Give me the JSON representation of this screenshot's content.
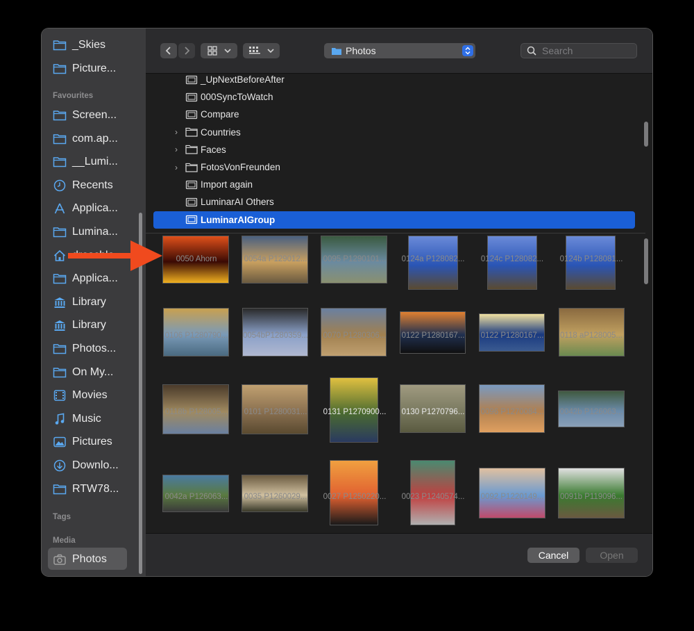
{
  "sidebar": {
    "top_items": [
      {
        "label": "_Skies",
        "icon": "folder-icon"
      },
      {
        "label": "Picture...",
        "icon": "folder-icon"
      }
    ],
    "favourites_header": "Favourites",
    "favourites": [
      {
        "label": "Screen...",
        "icon": "folder-icon"
      },
      {
        "label": "com.ap...",
        "icon": "folder-icon"
      },
      {
        "label": "__Lumi...",
        "icon": "folder-icon"
      },
      {
        "label": "Recents",
        "icon": "clock-icon"
      },
      {
        "label": "Applica...",
        "icon": "apps-icon"
      },
      {
        "label": "Lumina...",
        "icon": "folder-icon"
      },
      {
        "label": "dreschle",
        "icon": "home-icon"
      },
      {
        "label": "Applica...",
        "icon": "folder-icon"
      },
      {
        "label": "Library",
        "icon": "library-icon"
      },
      {
        "label": "Library",
        "icon": "library-icon"
      },
      {
        "label": "Photos...",
        "icon": "folder-icon"
      },
      {
        "label": "On My...",
        "icon": "folder-icon"
      },
      {
        "label": "Movies",
        "icon": "film-icon"
      },
      {
        "label": "Music",
        "icon": "music-icon"
      },
      {
        "label": "Pictures",
        "icon": "pictures-icon"
      },
      {
        "label": "Downlo...",
        "icon": "download-icon"
      },
      {
        "label": "RTW78...",
        "icon": "folder-icon"
      }
    ],
    "tags_header": "Tags",
    "media_header": "Media",
    "media_item": {
      "label": "Photos",
      "icon": "camera-icon"
    }
  },
  "toolbar": {
    "back_icon": "chevron-left-icon",
    "forward_icon": "chevron-right-icon",
    "view_icon": "grid-icon",
    "group_icon": "group-icon",
    "location": "Photos",
    "search_placeholder": "Search"
  },
  "list": {
    "rows": [
      {
        "label": "_UpNextBeforeAfter",
        "disclosure": ""
      },
      {
        "label": "000SyncToWatch",
        "disclosure": ""
      },
      {
        "label": "Compare",
        "disclosure": ""
      },
      {
        "label": "Countries",
        "disclosure": "›"
      },
      {
        "label": "Faces",
        "disclosure": "›"
      },
      {
        "label": "FotosVonFreunden",
        "disclosure": "›"
      },
      {
        "label": "Import again",
        "disclosure": ""
      },
      {
        "label": "LuminarAI Others",
        "disclosure": ""
      },
      {
        "label": "LuminarAIGroup",
        "disclosure": ""
      }
    ]
  },
  "grid": {
    "thumbs": [
      {
        "caption": "0050 Ahorn",
        "colors": [
          "#3a0a04",
          "#e0501a",
          "#f0b020"
        ]
      },
      {
        "caption": "0054a P129012...",
        "colors": [
          "#c9a060",
          "#4a6080",
          "#6a5a40"
        ]
      },
      {
        "caption": "0095 P1290101...",
        "colors": [
          "#6a8aa0",
          "#3a5a40",
          "#8a9070"
        ]
      },
      {
        "caption": "0124a P128082...",
        "colors": [
          "#2a55b5",
          "#6a8ad8",
          "#5a4a30"
        ]
      },
      {
        "caption": "0124c P128082...",
        "colors": [
          "#2a55b5",
          "#6a8ad8",
          "#5a4a30"
        ]
      },
      {
        "caption": "0124b P128081...",
        "colors": [
          "#2a55b5",
          "#6a8ad8",
          "#5a4a30"
        ]
      },
      {
        "caption": "0106 P1280790...",
        "colors": [
          "#7a9ab8",
          "#c8a050",
          "#4a6a80"
        ]
      },
      {
        "caption": "0054bP1280359...",
        "colors": [
          "#8aa0c8",
          "#2a2a2a",
          "#b0b8d0"
        ]
      },
      {
        "caption": "0070 P1280306...",
        "colors": [
          "#a08050",
          "#6a80a0",
          "#c0a070"
        ]
      },
      {
        "caption": "0122 P1280167...",
        "colors": [
          "#203050",
          "#e08030",
          "#101010"
        ]
      },
      {
        "caption": "0122 P1280167...",
        "colors": [
          "#1a3a80",
          "#f0e0a0",
          "#3a5a90"
        ]
      },
      {
        "caption": "0118 aP128005...",
        "colors": [
          "#c0a060",
          "#8a6a40",
          "#6a8a50"
        ]
      },
      {
        "caption": "0118b P128005...",
        "colors": [
          "#a08a60",
          "#4a3a2a",
          "#6a80a0"
        ]
      },
      {
        "caption": "0101 P1280031...",
        "colors": [
          "#8a7050",
          "#c0a070",
          "#5a4a30"
        ]
      },
      {
        "caption": "0131 P1270900...",
        "colors": [
          "#4a6a30",
          "#e0c040",
          "#2a3a60"
        ]
      },
      {
        "caption": "0130 P1270796...",
        "colors": [
          "#7a7a60",
          "#a09a80",
          "#5a5a40"
        ]
      },
      {
        "caption": "0096 P1270084...",
        "colors": [
          "#b08050",
          "#7a9ac0",
          "#e0a060"
        ]
      },
      {
        "caption": "0042b P126063...",
        "colors": [
          "#6a8aa8",
          "#405a40",
          "#8aa0b8"
        ]
      },
      {
        "caption": "0042a P126063...",
        "colors": [
          "#5a7a40",
          "#4a7aa0",
          "#3a3a3a"
        ]
      },
      {
        "caption": "0035 P1260029...",
        "colors": [
          "#d0c0a0",
          "#6a5a40",
          "#3a3a2a"
        ]
      },
      {
        "caption": "0027 P1250220...",
        "colors": [
          "#e06030",
          "#f0a040",
          "#1a1a1a"
        ]
      },
      {
        "caption": "0023 P1240574...",
        "colors": [
          "#c04040",
          "#4a8a70",
          "#b0b0b0"
        ]
      },
      {
        "caption": "0092 P1220149...",
        "colors": [
          "#6a9ad0",
          "#e0c0a0",
          "#c04a6a"
        ]
      },
      {
        "caption": "0091b P119096...",
        "colors": [
          "#3a7a30",
          "#e0e0e0",
          "#6a5a40"
        ]
      }
    ]
  },
  "buttons": {
    "cancel": "Cancel",
    "open": "Open"
  },
  "colors": {
    "accent": "#1a5fd6",
    "arrow": "#f04a1e"
  }
}
